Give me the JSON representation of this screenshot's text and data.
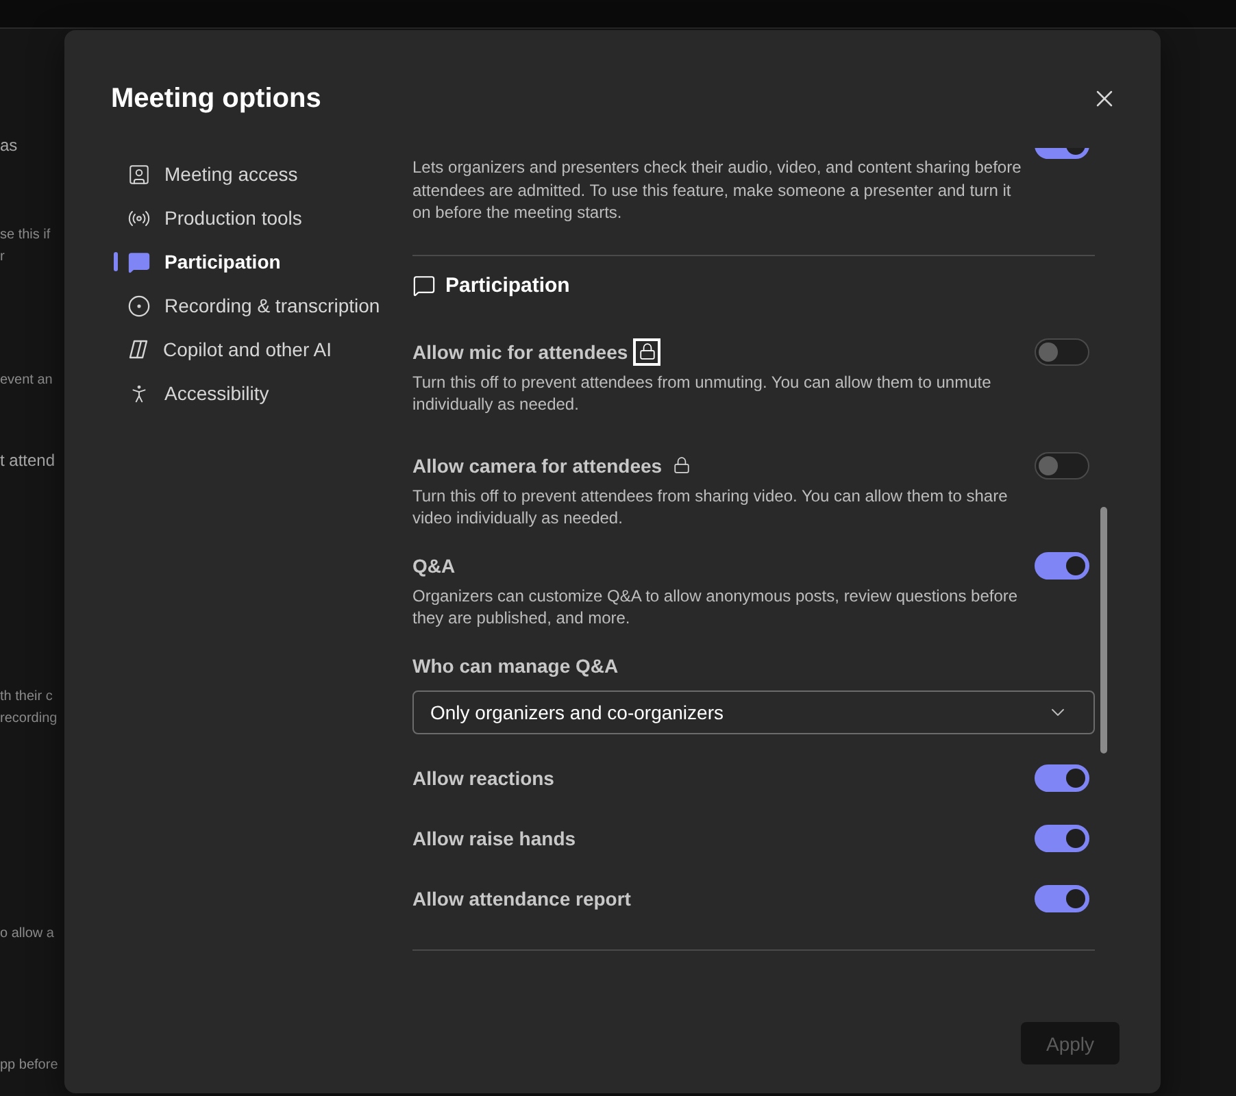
{
  "background": {
    "fragments": [
      "as",
      "se this if",
      "r",
      "event an",
      "t attend",
      "th their c",
      "recording",
      "o allow a",
      "pp before"
    ]
  },
  "dialog": {
    "title": "Meeting options",
    "nav": [
      {
        "label": "Meeting access",
        "selected": false
      },
      {
        "label": "Production tools",
        "selected": false
      },
      {
        "label": "Participation",
        "selected": true
      },
      {
        "label": "Recording & transcription",
        "selected": false
      },
      {
        "label": "Copilot and other AI",
        "selected": false
      },
      {
        "label": "Accessibility",
        "selected": false
      }
    ],
    "lead": {
      "description": "Lets organizers and presenters check their audio, video, and content sharing before attendees are admitted. To use this feature, make someone a presenter and turn it on before the meeting starts.",
      "on": true
    },
    "section": "Participation",
    "items": [
      {
        "kind": "toggle",
        "title": "Allow mic for attendees",
        "locked": true,
        "focused": true,
        "description": "Turn this off to prevent attendees from unmuting. You can allow them to unmute individually as needed.",
        "on": false
      },
      {
        "kind": "toggle",
        "title": "Allow camera for attendees",
        "locked": true,
        "description": "Turn this off to prevent attendees from sharing video. You can allow them to share video individually as needed.",
        "on": false
      },
      {
        "kind": "toggle",
        "title": "Q&A",
        "locked": false,
        "description": "Organizers can customize Q&A to allow anonymous posts, review questions before they are published, and more.",
        "on": true
      },
      {
        "kind": "select",
        "title": "Who can manage Q&A",
        "value": "Only organizers and co-organizers"
      },
      {
        "kind": "toggle",
        "title": "Allow reactions",
        "locked": false,
        "on": true
      },
      {
        "kind": "toggle",
        "title": "Allow raise hands",
        "locked": false,
        "on": true
      },
      {
        "kind": "toggle",
        "title": "Allow attendance report",
        "locked": false,
        "on": true
      }
    ],
    "apply": {
      "label": "Apply",
      "disabled": true
    }
  }
}
